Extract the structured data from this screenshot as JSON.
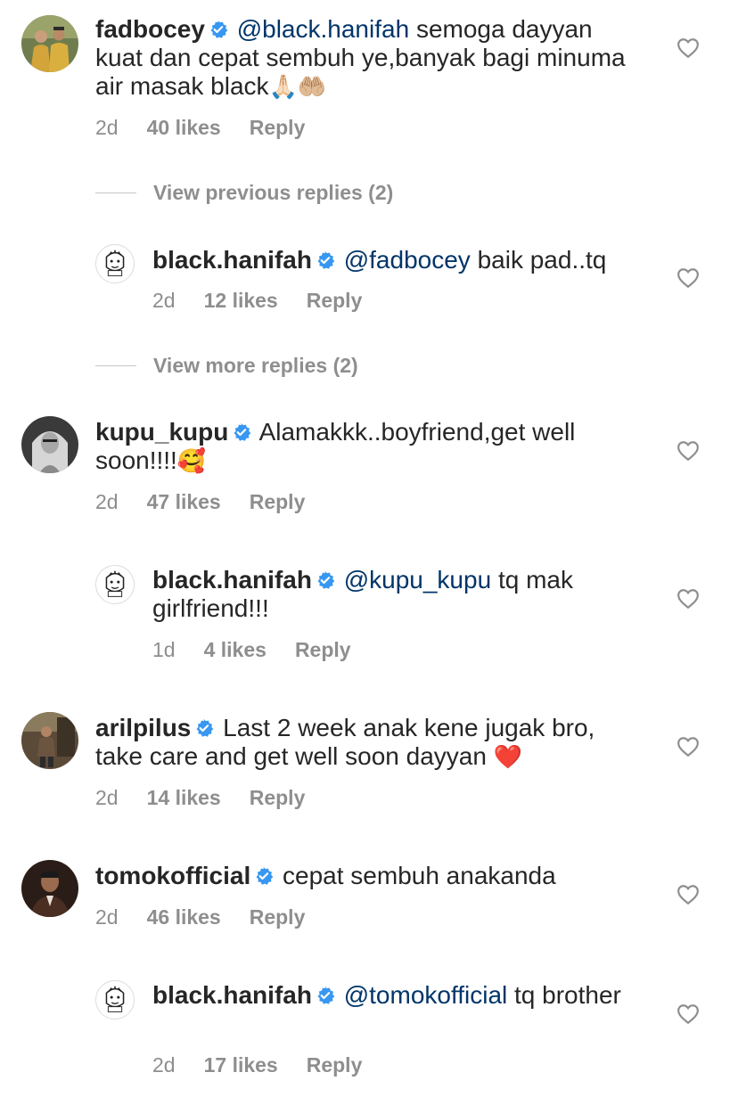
{
  "comments": [
    {
      "username": "fadbocey",
      "mention": "@black.hanifah",
      "text_line1": "semoga dayyan",
      "text_rest": "kuat dan cepat sembuh ye,banyak bagi minuma air masak black",
      "emoji": "🙏🏻🤲🏼",
      "time": "2d",
      "likes": "40 likes",
      "reply": "Reply",
      "avatar_icon": "couple-photo",
      "heart_icon": "heart-outline-icon"
    },
    {
      "username": "black.hanifah",
      "mention": "@fadbocey",
      "text": "baik pad..tq",
      "time": "2d",
      "likes": "12 likes",
      "reply": "Reply",
      "avatar_icon": "cartoon-logo"
    },
    {
      "username": "kupu_kupu",
      "text": "Alamakkk..boyfriend,get well soon!!!!",
      "emoji": "🥰",
      "time": "2d",
      "likes": "47 likes",
      "reply": "Reply",
      "avatar_icon": "bw-portrait"
    },
    {
      "username": "black.hanifah",
      "mention": "@kupu_kupu",
      "text": "tq mak girlfriend!!!",
      "time": "1d",
      "likes": "4 likes",
      "reply": "Reply",
      "avatar_icon": "cartoon-logo"
    },
    {
      "username": "arilpilus",
      "text": "Last 2 week anak kene jugak bro, take care and get well soon dayyan",
      "emoji": "❤️",
      "time": "2d",
      "likes": "14 likes",
      "reply": "Reply",
      "avatar_icon": "outdoor-photo"
    },
    {
      "username": "tomokofficial",
      "text": "cepat sembuh anakanda",
      "time": "2d",
      "likes": "46 likes",
      "reply": "Reply",
      "avatar_icon": "suit-portrait"
    },
    {
      "username": "black.hanifah",
      "mention": "@tomokofficial",
      "text": "tq brother",
      "time": "2d",
      "likes": "17 likes",
      "reply": "Reply",
      "avatar_icon": "cartoon-logo"
    }
  ],
  "view_previous_replies": "View previous replies (2)",
  "view_more_replies": "View more replies (2)",
  "colors": {
    "text": "#262626",
    "meta": "#8e8e8e",
    "mention": "#003569",
    "verified": "#3897f0",
    "heart_outline": "#8e8e8e"
  }
}
